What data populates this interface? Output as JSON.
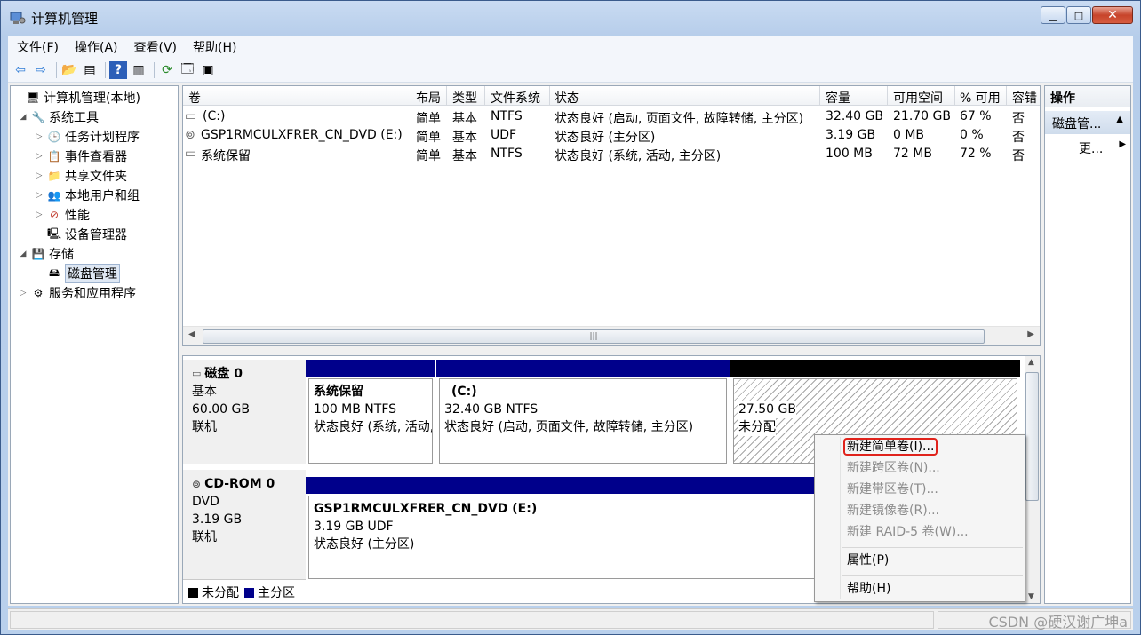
{
  "window": {
    "title": "计算机管理"
  },
  "menu": [
    "文件(F)",
    "操作(A)",
    "查看(V)",
    "帮助(H)"
  ],
  "tree": [
    {
      "label": "计算机管理(本地)",
      "tri": "",
      "icon": "🖥"
    },
    {
      "label": "系统工具",
      "tri": "◢",
      "icon": "🔧"
    },
    {
      "label": "任务计划程序",
      "tri": "▷",
      "icon": "🕒"
    },
    {
      "label": "事件查看器",
      "tri": "▷",
      "icon": "📋"
    },
    {
      "label": "共享文件夹",
      "tri": "▷",
      "icon": "📁"
    },
    {
      "label": "本地用户和组",
      "tri": "▷",
      "icon": "👥"
    },
    {
      "label": "性能",
      "tri": "▷",
      "icon": "⊘"
    },
    {
      "label": "设备管理器",
      "tri": "",
      "icon": "🖳"
    },
    {
      "label": "存储",
      "tri": "◢",
      "icon": "💾"
    },
    {
      "label": "磁盘管理",
      "tri": "",
      "icon": "🖴"
    },
    {
      "label": "服务和应用程序",
      "tri": "▷",
      "icon": "⚙"
    }
  ],
  "volumes": {
    "headers": [
      "卷",
      "布局",
      "类型",
      "文件系统",
      "状态",
      "容量",
      "可用空间",
      "% 可用",
      "容错"
    ],
    "rows": [
      [
        "(C:)",
        "简单",
        "基本",
        "NTFS",
        "状态良好 (启动, 页面文件, 故障转储, 主分区)",
        "32.40 GB",
        "21.70 GB",
        "67 %",
        "否"
      ],
      [
        "GSP1RMCULXFRER_CN_DVD (E:)",
        "简单",
        "基本",
        "UDF",
        "状态良好 (主分区)",
        "3.19 GB",
        "0 MB",
        "0 %",
        "否"
      ],
      [
        "系统保留",
        "简单",
        "基本",
        "NTFS",
        "状态良好 (系统, 活动, 主分区)",
        "100 MB",
        "72 MB",
        "72 %",
        "否"
      ]
    ]
  },
  "disk0": {
    "name": "磁盘 0",
    "type": "基本",
    "size": "60.00 GB",
    "status": "联机",
    "parts": [
      {
        "name": "系统保留",
        "size": "100 MB NTFS",
        "status": "状态良好 (系统, 活动, 主分区)"
      },
      {
        "name": "(C:)",
        "size": "32.40 GB NTFS",
        "status": "状态良好 (启动, 页面文件, 故障转储, 主分区)"
      },
      {
        "size": "27.50 GB",
        "status": "未分配"
      }
    ]
  },
  "cdrom0": {
    "name": "CD-ROM 0",
    "type": "DVD",
    "size": "3.19 GB",
    "status": "联机",
    "part": {
      "name": "GSP1RMCULXFRER_CN_DVD  (E:)",
      "size": "3.19 GB UDF",
      "status": "状态良好 (主分区)"
    }
  },
  "legend": {
    "unallocated": "未分配",
    "primary": "主分区"
  },
  "actions": {
    "header": "操作",
    "sub": "磁盘管...",
    "more": "更..."
  },
  "context_menu": [
    "新建简单卷(I)...",
    "新建跨区卷(N)...",
    "新建带区卷(T)...",
    "新建镜像卷(R)...",
    "新建 RAID-5 卷(W)...",
    "属性(P)",
    "帮助(H)"
  ],
  "watermark": "CSDN @硬汉谢广坤a",
  "colors": {
    "primary": "#00008b",
    "unallocated": "#000000",
    "highlight": "#e0231c"
  }
}
